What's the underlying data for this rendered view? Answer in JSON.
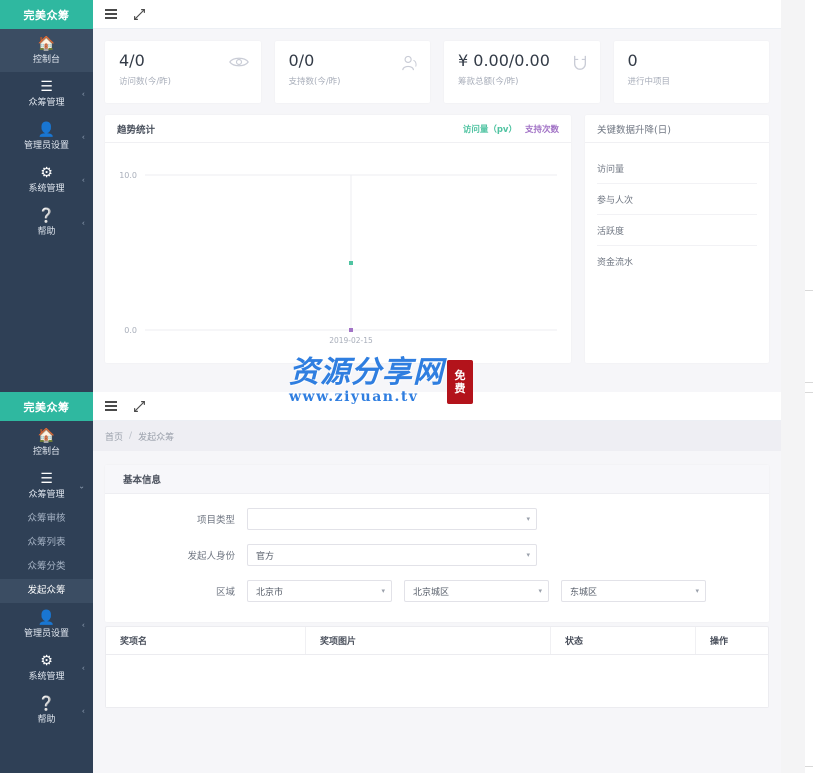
{
  "brand": {
    "name": "完美众筹"
  },
  "topbar": {
    "menu_icon": "hamburger-icon",
    "fullscreen_icon": "expand-arrows-icon"
  },
  "sidebar": {
    "items": [
      {
        "label": "控制台",
        "icon": "home-icon",
        "active": true,
        "caret": ""
      },
      {
        "label": "众筹管理",
        "icon": "list-icon",
        "active": false,
        "caret": "‹"
      },
      {
        "label": "管理员设置",
        "icon": "user-icon",
        "active": false,
        "caret": "‹"
      },
      {
        "label": "系统管理",
        "icon": "gear-icon",
        "active": false,
        "caret": "‹"
      },
      {
        "label": "帮助",
        "icon": "question-circle-icon",
        "active": false,
        "caret": "‹"
      }
    ],
    "items_b": [
      {
        "label": "控制台",
        "icon": "home-icon",
        "active": false,
        "caret": ""
      },
      {
        "label": "众筹管理",
        "icon": "list-icon",
        "active": false,
        "caret": "⌄"
      },
      {
        "label": "管理员设置",
        "icon": "user-icon",
        "active": false,
        "caret": "‹"
      },
      {
        "label": "系统管理",
        "icon": "gear-icon",
        "active": false,
        "caret": "‹"
      },
      {
        "label": "帮助",
        "icon": "question-circle-icon",
        "active": false,
        "caret": "‹"
      }
    ],
    "submenu": [
      {
        "label": "众筹审核",
        "active": false
      },
      {
        "label": "众筹列表",
        "active": false
      },
      {
        "label": "众筹分类",
        "active": false
      },
      {
        "label": "发起众筹",
        "active": true
      }
    ]
  },
  "dashboard": {
    "stats": [
      {
        "value": "4/0",
        "label": "访问数(今/昨)",
        "icon": "eye-icon"
      },
      {
        "value": "0/0",
        "label": "支持数(今/昨)",
        "icon": "user-group-icon"
      },
      {
        "value": "¥ 0.00/0.00",
        "label": "筹款总额(今/昨)",
        "icon": "magnet-icon"
      },
      {
        "value": "0",
        "label": "进行中项目",
        "icon": ""
      }
    ],
    "trend_panel": {
      "title": "趋势统计",
      "legend": [
        {
          "label": "访问量（pv）",
          "color": "#4fc3a1"
        },
        {
          "label": "支持次数",
          "color": "#a273c6"
        }
      ]
    },
    "key_panel": {
      "title": "关键数据升降(日)",
      "rows": [
        "访问量",
        "参与人次",
        "活跃度",
        "资金流水"
      ]
    }
  },
  "chart_data": {
    "type": "line",
    "title": "趋势统计",
    "xlabel": "",
    "ylabel": "",
    "x": [
      "2019-02-15"
    ],
    "ytick_labels": [
      "0.0",
      "10.0"
    ],
    "ylim": [
      0,
      10
    ],
    "grid": true,
    "legend_position": "top-right",
    "series": [
      {
        "name": "访问量（pv）",
        "color": "#4fc3a1",
        "values": [
          4
        ]
      },
      {
        "name": "支持次数",
        "color": "#a273c6",
        "values": [
          0
        ]
      }
    ]
  },
  "launch_page": {
    "breadcrumb": {
      "home": "首页",
      "sep": "/",
      "current": "发起众筹"
    },
    "card_title": "基本信息",
    "fields": [
      {
        "label": "项目类型",
        "value": "",
        "arrow": "▾"
      },
      {
        "label": "发起人身份",
        "value": "官方",
        "arrow": "▾"
      }
    ],
    "region": {
      "label": "区域",
      "values": [
        "北京市",
        "北京城区",
        "东城区"
      ],
      "arrow": "▾"
    },
    "table": {
      "headers": [
        "奖项名",
        "奖项图片",
        "状态",
        "操作"
      ]
    }
  },
  "watermark": {
    "cn": "资源分享网",
    "url": "www.ziyuan.tv",
    "seal_top": "免",
    "seal_bottom": "费"
  }
}
